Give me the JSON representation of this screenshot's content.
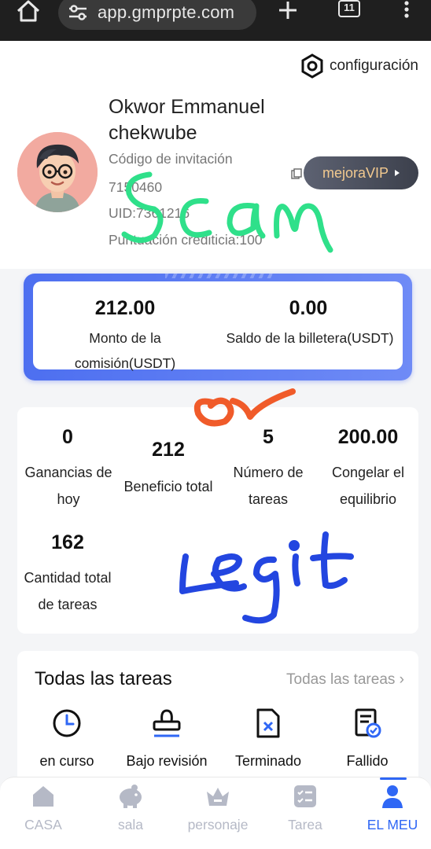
{
  "browser": {
    "url": "app.gmprpte.com",
    "tab_count": "11"
  },
  "header": {
    "config_label": "configuración"
  },
  "profile": {
    "name": "Okwor Emmanuel chekwube",
    "invite_label": "Código de invitación",
    "invite_code": "7150460",
    "uid": "UID:7361216",
    "credit": "Puntuación crediticia:100",
    "vip_button": "mejoraVIP"
  },
  "wallet": {
    "commission_value": "212.00",
    "commission_label": "Monto de la comisión(USDT)",
    "balance_value": "0.00",
    "balance_label": "Saldo de la billetera(USDT)"
  },
  "stats": [
    {
      "value": "0",
      "label": "Ganancias de hoy"
    },
    {
      "value": "212",
      "label": "Beneficio total"
    },
    {
      "value": "5",
      "label": "Número de tareas"
    },
    {
      "value": "200.00",
      "label": "Congelar el equilibrio"
    },
    {
      "value": "162",
      "label": "Cantidad total de tareas"
    }
  ],
  "tasks": {
    "title": "Todas las tareas",
    "all_link": "Todas las tareas",
    "items": [
      {
        "label": "en curso",
        "icon": "clock-icon"
      },
      {
        "label": "Bajo revisión",
        "icon": "stamp-icon"
      },
      {
        "label": "Terminado",
        "icon": "document-x-icon"
      },
      {
        "label": "Fallido",
        "icon": "checklist-check-icon"
      }
    ]
  },
  "nav": [
    {
      "label": "CASA",
      "icon": "home-icon",
      "active": false
    },
    {
      "label": "sala",
      "icon": "piggy-bank-icon",
      "active": false
    },
    {
      "label": "personaje",
      "icon": "crown-icon",
      "active": false
    },
    {
      "label": "Tarea",
      "icon": "task-list-icon",
      "active": false
    },
    {
      "label": "EL MEU",
      "icon": "user-icon",
      "active": true
    }
  ],
  "colors": {
    "accent": "#2f67f5",
    "wallet_gradient_start": "#4d6ff0",
    "vip_text": "#f2c98f",
    "nav_inactive": "#b5b9c6",
    "annotation_scam": "#2fe08a",
    "annotation_check": "#f05b2a",
    "annotation_legit": "#2346e0"
  },
  "annotations": {
    "scam_text": "Scam",
    "legit_text": "Legit"
  }
}
